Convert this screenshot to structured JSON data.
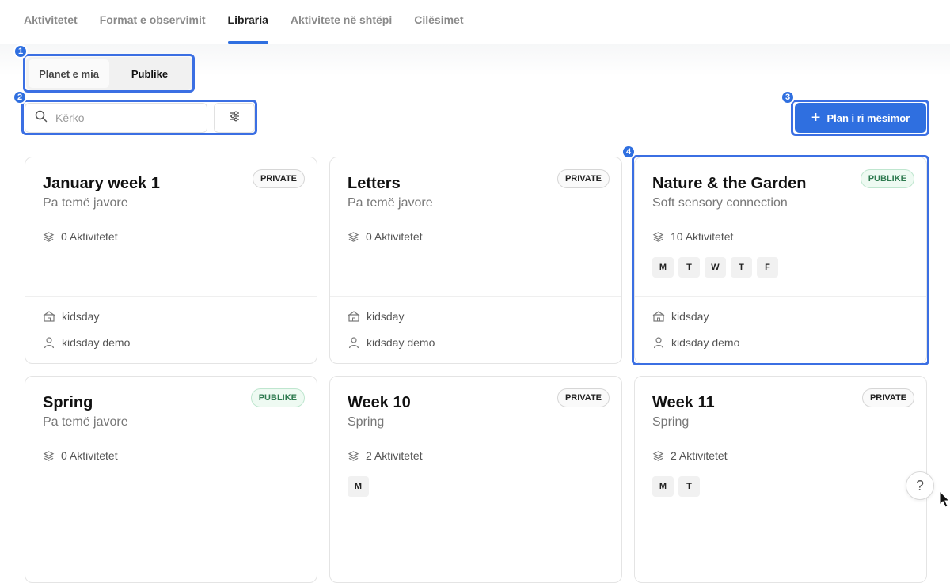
{
  "nav": {
    "tabs": [
      {
        "label": "Aktivitetet"
      },
      {
        "label": "Format e observimit"
      },
      {
        "label": "Libraria"
      },
      {
        "label": "Aktivitete në shtëpi"
      },
      {
        "label": "Cilësimet"
      }
    ],
    "active_index": 2
  },
  "segment": {
    "options": [
      "Planet e mia",
      "Publike"
    ],
    "selected": "Publike"
  },
  "search": {
    "placeholder": "Kërko",
    "value": ""
  },
  "new_plan_label": "Plan i ri mësimor",
  "markers": [
    "1",
    "2",
    "3",
    "4"
  ],
  "cards": [
    {
      "title": "January week 1",
      "subtitle": "Pa temë javore",
      "badge": "PRIVATE",
      "activities": "0 Aktivitetet",
      "days": [],
      "org": "kidsday",
      "owner": "kidsday demo"
    },
    {
      "title": "Letters",
      "subtitle": "Pa temë javore",
      "badge": "PRIVATE",
      "activities": "0 Aktivitetet",
      "days": [],
      "org": "kidsday",
      "owner": "kidsday demo"
    },
    {
      "title": "Nature & the Garden",
      "subtitle": "Soft sensory connection",
      "badge": "PUBLIKE",
      "activities": "10 Aktivitetet",
      "days": [
        "M",
        "T",
        "W",
        "T",
        "F"
      ],
      "org": "kidsday",
      "owner": "kidsday demo"
    },
    {
      "title": "Spring",
      "subtitle": "Pa temë javore",
      "badge": "PUBLIKE",
      "activities": "0 Aktivitetet",
      "days": [],
      "org": "",
      "owner": ""
    },
    {
      "title": "Week 10",
      "subtitle": "Spring",
      "badge": "PRIVATE",
      "activities": "2 Aktivitetet",
      "days": [
        "M"
      ],
      "org": "",
      "owner": ""
    },
    {
      "title": "Week 11",
      "subtitle": "Spring",
      "badge": "PRIVATE",
      "activities": "2 Aktivitetet",
      "days": [
        "M",
        "T"
      ],
      "org": "",
      "owner": ""
    }
  ],
  "help_label": "?",
  "colors": {
    "accent": "#2f6fe0",
    "public_badge": "#2e7a4f"
  }
}
